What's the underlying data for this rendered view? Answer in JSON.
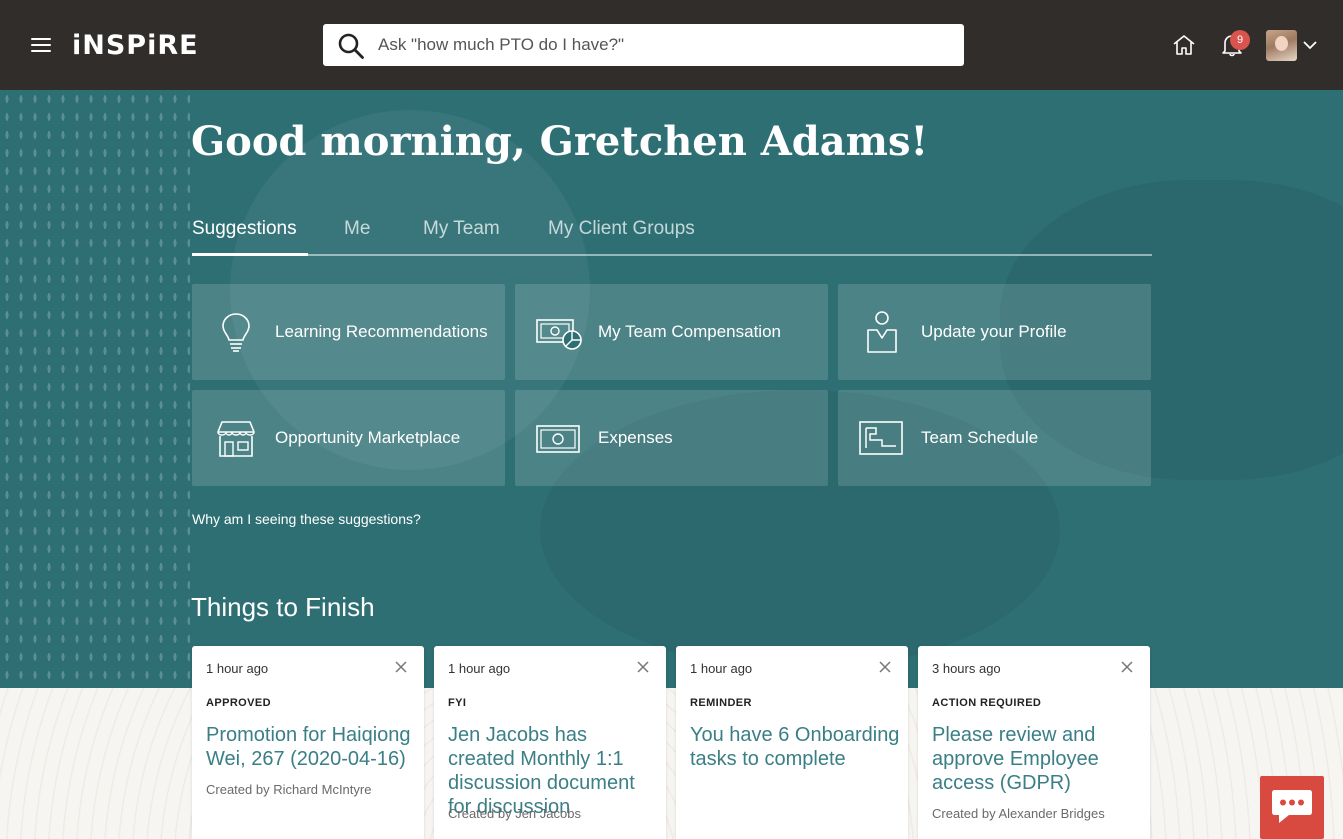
{
  "header": {
    "logo": "iNSPiRE",
    "search_placeholder": "Ask \"how much PTO do I have?\"",
    "notification_count": "9"
  },
  "hero": {
    "greeting": "Good morning, Gretchen Adams!",
    "tabs": [
      {
        "label": "Suggestions",
        "active": true
      },
      {
        "label": "Me"
      },
      {
        "label": "My Team"
      },
      {
        "label": "My Client Groups"
      }
    ],
    "tiles": [
      {
        "label": "Learning Recommendations",
        "icon": "lightbulb-icon"
      },
      {
        "label": "My Team Compensation",
        "icon": "money-chart-icon"
      },
      {
        "label": "Update your Profile",
        "icon": "person-badge-icon"
      },
      {
        "label": "Opportunity Marketplace",
        "icon": "storefront-icon"
      },
      {
        "label": "Expenses",
        "icon": "cash-icon"
      },
      {
        "label": "Team Schedule",
        "icon": "schedule-board-icon"
      }
    ],
    "why_link": "Why am I seeing these suggestions?"
  },
  "things_to_finish": {
    "title": "Things to Finish",
    "cards": [
      {
        "time": "1 hour ago",
        "category": "APPROVED",
        "title": "Promotion for Haiqiong Wei, 267 (2020-04-16)",
        "created_by": "Created by Richard McIntyre"
      },
      {
        "time": "1 hour ago",
        "category": "FYI",
        "title": "Jen Jacobs has created Monthly 1:1 discussion document for discussion",
        "created_by": "Created by Jen Jacobs"
      },
      {
        "time": "1 hour ago",
        "category": "REMINDER",
        "title": "You have 6 Onboarding tasks to complete",
        "created_by": ""
      },
      {
        "time": "3 hours ago",
        "category": "ACTION REQUIRED",
        "title": "Please review and approve Employee access (GDPR)",
        "created_by": "Created by Alexander Bridges"
      }
    ]
  },
  "colors": {
    "topbar": "#312d2a",
    "hero": "#2e6f74",
    "card_title": "#3a7f86",
    "badge": "#d9534f",
    "chat_button": "#d84a3f"
  }
}
